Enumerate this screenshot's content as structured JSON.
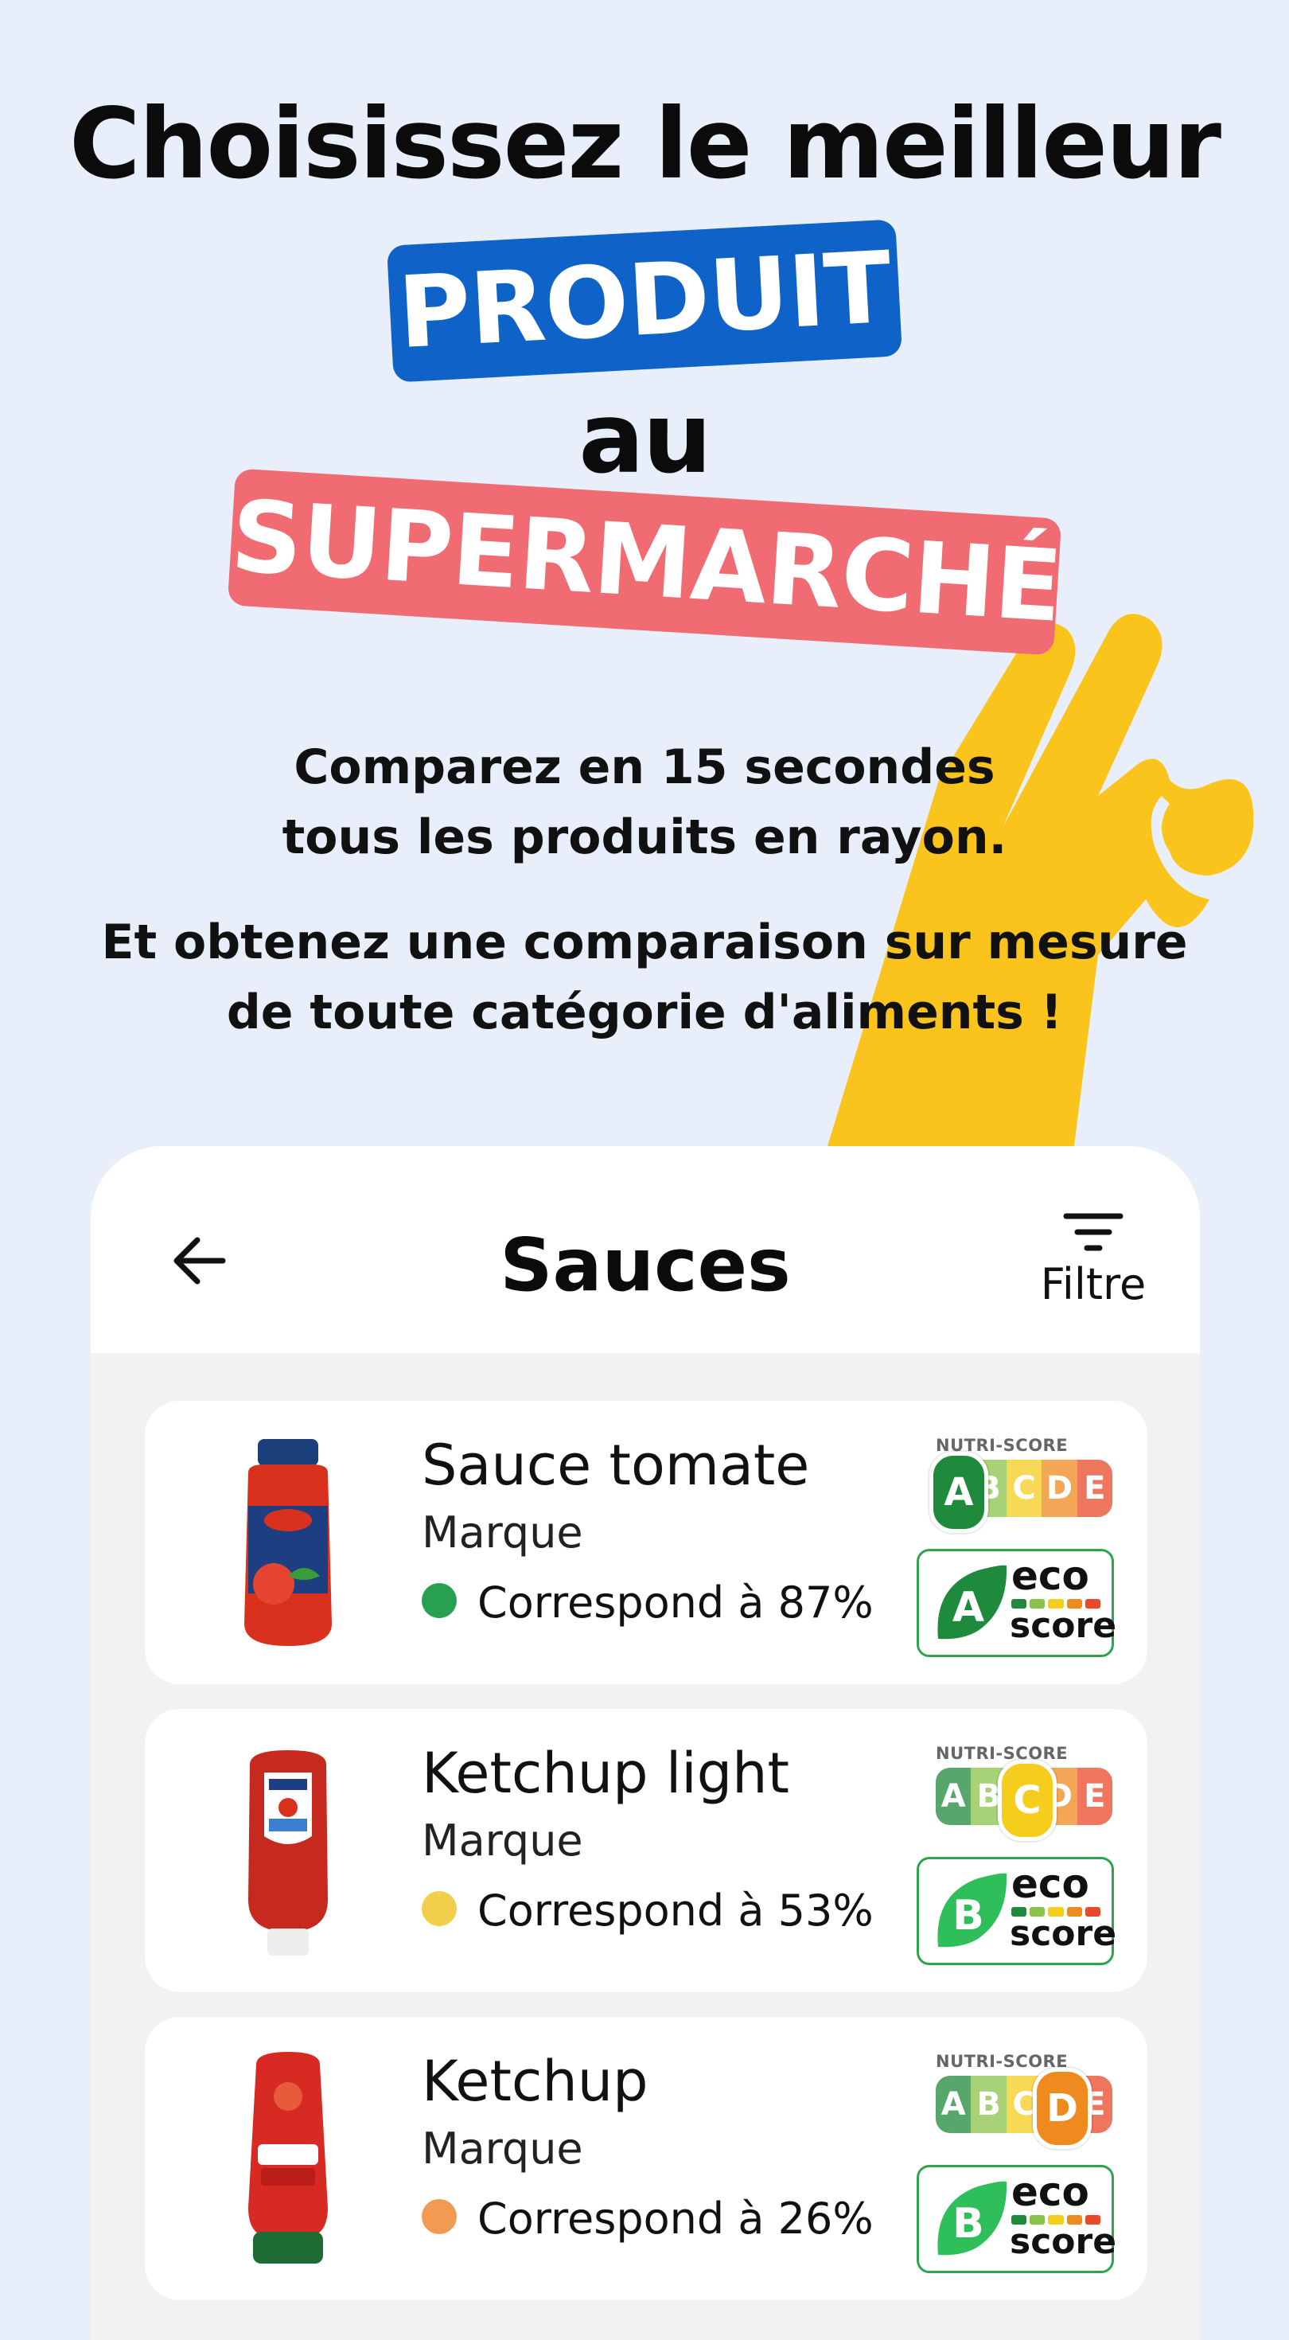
{
  "hero": {
    "line1": "Choisissez le meilleur",
    "tag1": "PRODUIT",
    "line2": "au",
    "tag2": "SUPERMARCHÉ",
    "sub1a": "Comparez en 15 secondes",
    "sub1b": "tous les produits en rayon.",
    "sub2a": "Et obtenez une comparaison sur mesure",
    "sub2b": "de toute catégorie d'aliments !"
  },
  "screen": {
    "title": "Sauces",
    "filter_label": "Filtre",
    "back_icon": "arrow-left-icon",
    "filter_icon": "filter-icon"
  },
  "nutri_label": "NUTRI-SCORE",
  "nutri_letters": [
    "A",
    "B",
    "C",
    "D",
    "E"
  ],
  "eco_word1": "eco",
  "eco_word2": "score",
  "products": [
    {
      "name": "Sauce tomate",
      "brand": "Marque",
      "match": "Correspond à 87%",
      "match_color": "#27a052",
      "nutri": "A",
      "eco": "A",
      "eco_color": "#1e8a3c"
    },
    {
      "name": "Ketchup light",
      "brand": "Marque",
      "match": "Correspond à 53%",
      "match_color": "#f2cf4a",
      "nutri": "C",
      "eco": "B",
      "eco_color": "#2fbf5a"
    },
    {
      "name": "Ketchup",
      "brand": "Marque",
      "match": "Correspond à 26%",
      "match_color": "#f29a52",
      "nutri": "D",
      "eco": "B",
      "eco_color": "#2fbf5a"
    }
  ],
  "colors": {
    "background": "#e8effb",
    "tag_blue": "#0e62c8",
    "tag_red": "#f06b72",
    "hand_yellow": "#fbc41c",
    "nutri": [
      "#1f8a3c",
      "#8bc34a",
      "#f5cd1c",
      "#ef8a1e",
      "#e8492a"
    ]
  }
}
